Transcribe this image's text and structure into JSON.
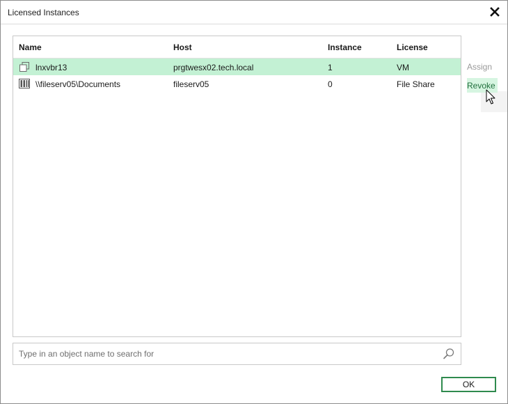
{
  "window": {
    "title": "Licensed Instances"
  },
  "grid": {
    "columns": {
      "name": "Name",
      "host": "Host",
      "instance": "Instance",
      "license": "License"
    },
    "rows": [
      {
        "icon": "vm-icon",
        "name": "lnxvbr13",
        "host": "prgtwesx02.tech.local",
        "instance": "1",
        "license": "VM",
        "selected": true
      },
      {
        "icon": "file-share-icon",
        "name": "\\\\fileserv05\\Documents",
        "host": "fileserv05",
        "instance": "0",
        "license": "File Share",
        "selected": false
      }
    ]
  },
  "actions": {
    "assign": "Assign",
    "revoke": "Revoke"
  },
  "search": {
    "placeholder": "Type in an object name to search for",
    "value": ""
  },
  "buttons": {
    "ok": "OK"
  },
  "colors": {
    "selection": "#c3f1d4",
    "accent": "#2f8a4e"
  }
}
